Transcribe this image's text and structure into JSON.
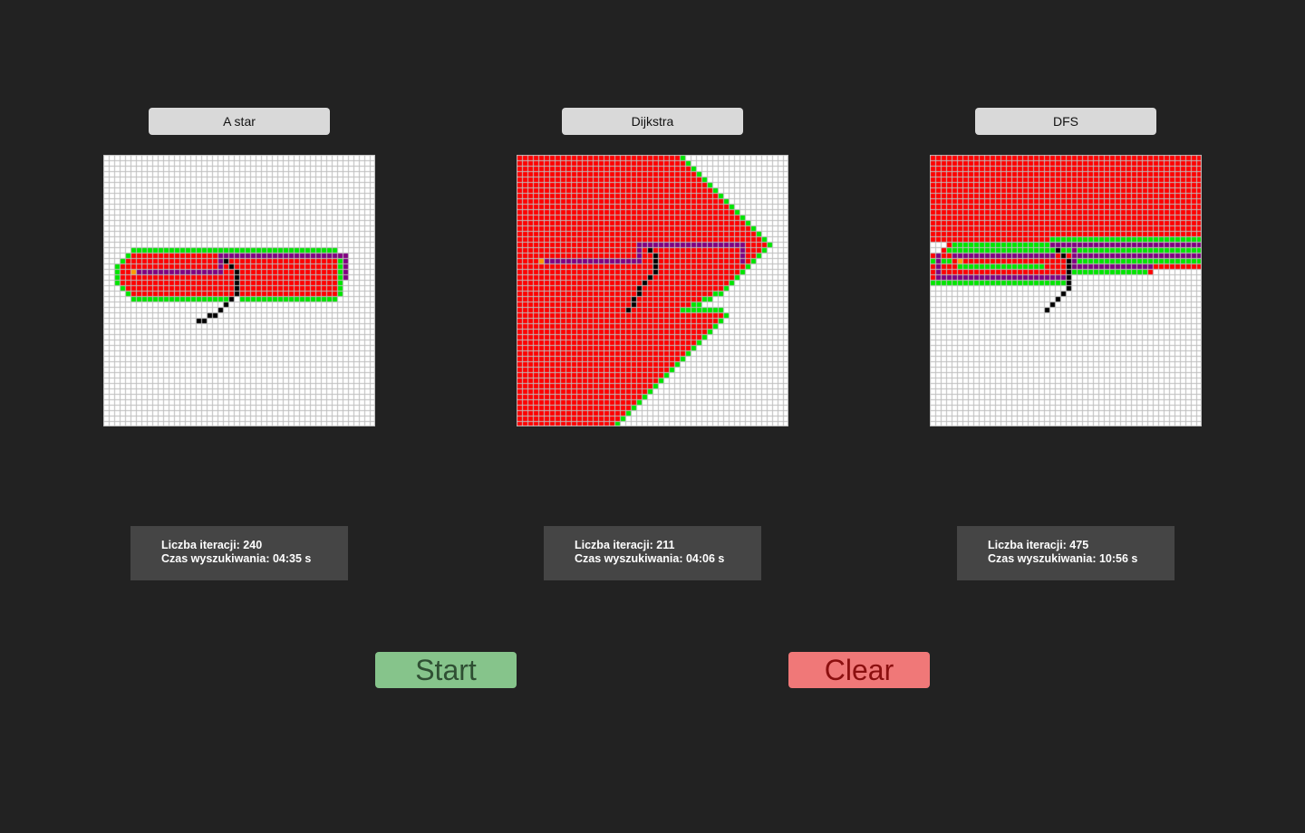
{
  "colors": {
    "background": "#222222",
    "tab_bg": "#d9d9d9",
    "grid_line": "#bdbdbd",
    "grid_bg": "#ffffff",
    "visited": "#ff0000",
    "frontier": "#00e600",
    "path": "#800080",
    "wall": "#000000",
    "start_node": "#ff9900",
    "stats_bg": "#454545",
    "start_button": "#86c48b",
    "clear_button": "#f07878"
  },
  "grid": {
    "rows": 50,
    "cols": 50
  },
  "panels": [
    {
      "id": "astar",
      "title": "A star",
      "iterations_text": "Liczba iteracji: 240",
      "time_text": "Czas wyszukiwania: 04:35 s"
    },
    {
      "id": "dijkstra",
      "title": "Dijkstra",
      "iterations_text": "Liczba iteracji: 211",
      "time_text": "Czas wyszukiwania: 04:06 s"
    },
    {
      "id": "dfs",
      "title": "DFS",
      "iterations_text": "Liczba iteracji: 475",
      "time_text": "Czas wyszukiwania: 10:56 s"
    }
  ],
  "buttons": {
    "start_label": "Start",
    "clear_label": "Clear"
  }
}
